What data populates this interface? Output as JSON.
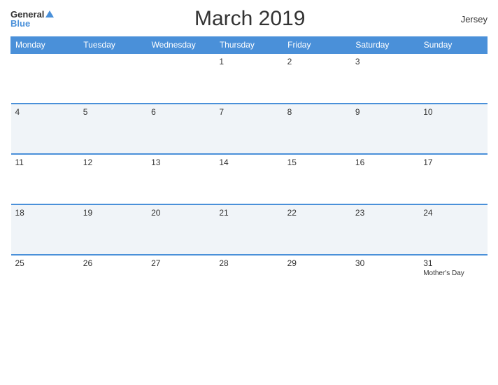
{
  "header": {
    "logo_general": "General",
    "logo_blue": "Blue",
    "title": "March 2019",
    "location": "Jersey"
  },
  "calendar": {
    "days_of_week": [
      "Monday",
      "Tuesday",
      "Wednesday",
      "Thursday",
      "Friday",
      "Saturday",
      "Sunday"
    ],
    "weeks": [
      [
        {
          "day": "",
          "events": []
        },
        {
          "day": "",
          "events": []
        },
        {
          "day": "",
          "events": []
        },
        {
          "day": "1",
          "events": []
        },
        {
          "day": "2",
          "events": []
        },
        {
          "day": "3",
          "events": []
        }
      ],
      [
        {
          "day": "4",
          "events": []
        },
        {
          "day": "5",
          "events": []
        },
        {
          "day": "6",
          "events": []
        },
        {
          "day": "7",
          "events": []
        },
        {
          "day": "8",
          "events": []
        },
        {
          "day": "9",
          "events": []
        },
        {
          "day": "10",
          "events": []
        }
      ],
      [
        {
          "day": "11",
          "events": []
        },
        {
          "day": "12",
          "events": []
        },
        {
          "day": "13",
          "events": []
        },
        {
          "day": "14",
          "events": []
        },
        {
          "day": "15",
          "events": []
        },
        {
          "day": "16",
          "events": []
        },
        {
          "day": "17",
          "events": []
        }
      ],
      [
        {
          "day": "18",
          "events": []
        },
        {
          "day": "19",
          "events": []
        },
        {
          "day": "20",
          "events": []
        },
        {
          "day": "21",
          "events": []
        },
        {
          "day": "22",
          "events": []
        },
        {
          "day": "23",
          "events": []
        },
        {
          "day": "24",
          "events": []
        }
      ],
      [
        {
          "day": "25",
          "events": []
        },
        {
          "day": "26",
          "events": []
        },
        {
          "day": "27",
          "events": []
        },
        {
          "day": "28",
          "events": []
        },
        {
          "day": "29",
          "events": []
        },
        {
          "day": "30",
          "events": []
        },
        {
          "day": "31",
          "events": [
            "Mother's Day"
          ]
        }
      ]
    ]
  }
}
